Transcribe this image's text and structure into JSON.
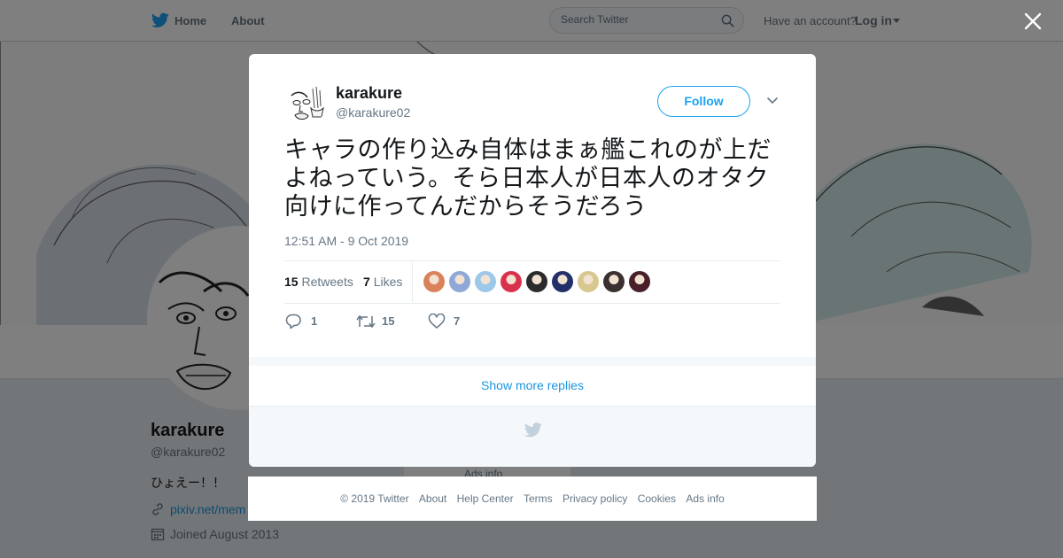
{
  "topbar": {
    "home_label": "Home",
    "about_label": "About",
    "search_placeholder": "Search Twitter",
    "have_account": "Have an account?",
    "login_label": "Log in"
  },
  "profile": {
    "name": "karakure",
    "handle": "@karakure02",
    "bio": "ひょえー！！",
    "link": "pixiv.net/mem",
    "joined": "Joined August 2013",
    "ads_info": "Ads info"
  },
  "tweet": {
    "author_name": "karakure",
    "author_handle": "@karakure02",
    "follow_label": "Follow",
    "text": "キャラの作り込み自体はまぁ艦これのが上だよねっていう。そら日本人が日本人のオタク向けに作ってんだからそうだろう",
    "timestamp": "12:51 AM - 9 Oct 2019",
    "retweets_count": "15",
    "retweets_label": "Retweets",
    "likes_count": "7",
    "likes_label": "Likes",
    "reply_count": "1",
    "retweet_action_count": "15",
    "like_action_count": "7",
    "liker_colors": [
      "#d9825b",
      "#8fa8d8",
      "#9cc8ea",
      "#d8314c",
      "#2b2b2b",
      "#24306a",
      "#d8c890",
      "#3a3030",
      "#4a1f2a"
    ]
  },
  "modal": {
    "show_more_replies": "Show more replies"
  },
  "footer": {
    "copyright": "© 2019 Twitter",
    "about": "About",
    "help_center": "Help Center",
    "terms": "Terms",
    "privacy": "Privacy policy",
    "cookies": "Cookies",
    "ads_info": "Ads info"
  },
  "colors": {
    "accent": "#1da1f2",
    "link": "#1b95e0",
    "secondary_text": "#657786"
  }
}
